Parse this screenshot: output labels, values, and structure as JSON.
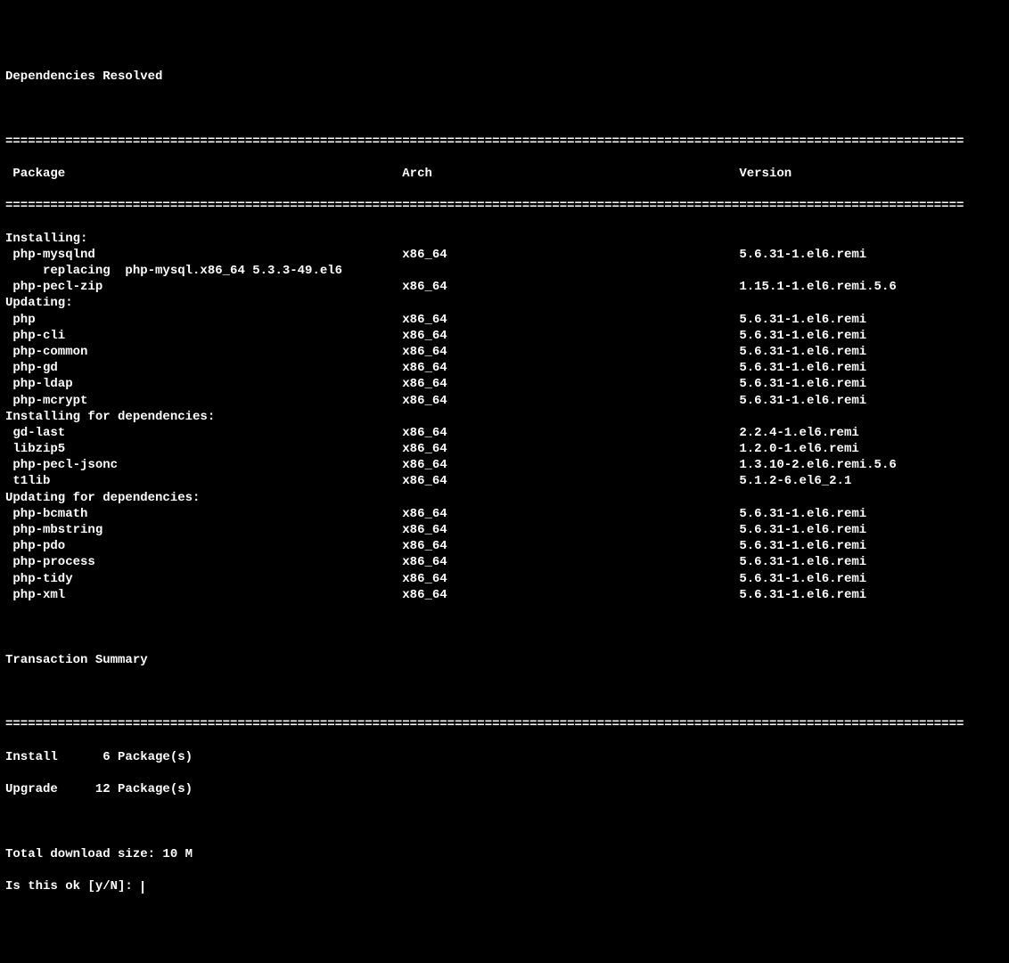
{
  "title": "Dependencies Resolved",
  "separator": "================================================================================================================================",
  "headers": {
    "package": "Package",
    "arch": "Arch",
    "version": "Version"
  },
  "sections": [
    {
      "label": "Installing:",
      "rows": [
        {
          "name": "php-mysqlnd",
          "arch": "x86_64",
          "version": "5.6.31-1.el6.remi",
          "sub": "replacing  php-mysql.x86_64 5.3.3-49.el6"
        },
        {
          "name": "php-pecl-zip",
          "arch": "x86_64",
          "version": "1.15.1-1.el6.remi.5.6"
        }
      ]
    },
    {
      "label": "Updating:",
      "rows": [
        {
          "name": "php",
          "arch": "x86_64",
          "version": "5.6.31-1.el6.remi"
        },
        {
          "name": "php-cli",
          "arch": "x86_64",
          "version": "5.6.31-1.el6.remi"
        },
        {
          "name": "php-common",
          "arch": "x86_64",
          "version": "5.6.31-1.el6.remi"
        },
        {
          "name": "php-gd",
          "arch": "x86_64",
          "version": "5.6.31-1.el6.remi"
        },
        {
          "name": "php-ldap",
          "arch": "x86_64",
          "version": "5.6.31-1.el6.remi"
        },
        {
          "name": "php-mcrypt",
          "arch": "x86_64",
          "version": "5.6.31-1.el6.remi"
        }
      ]
    },
    {
      "label": "Installing for dependencies:",
      "rows": [
        {
          "name": "gd-last",
          "arch": "x86_64",
          "version": "2.2.4-1.el6.remi"
        },
        {
          "name": "libzip5",
          "arch": "x86_64",
          "version": "1.2.0-1.el6.remi"
        },
        {
          "name": "php-pecl-jsonc",
          "arch": "x86_64",
          "version": "1.3.10-2.el6.remi.5.6"
        },
        {
          "name": "t1lib",
          "arch": "x86_64",
          "version": "5.1.2-6.el6_2.1"
        }
      ]
    },
    {
      "label": "Updating for dependencies:",
      "rows": [
        {
          "name": "php-bcmath",
          "arch": "x86_64",
          "version": "5.6.31-1.el6.remi"
        },
        {
          "name": "php-mbstring",
          "arch": "x86_64",
          "version": "5.6.31-1.el6.remi"
        },
        {
          "name": "php-pdo",
          "arch": "x86_64",
          "version": "5.6.31-1.el6.remi"
        },
        {
          "name": "php-process",
          "arch": "x86_64",
          "version": "5.6.31-1.el6.remi"
        },
        {
          "name": "php-tidy",
          "arch": "x86_64",
          "version": "5.6.31-1.el6.remi"
        },
        {
          "name": "php-xml",
          "arch": "x86_64",
          "version": "5.6.31-1.el6.remi"
        }
      ]
    }
  ],
  "summary": {
    "title": "Transaction Summary",
    "install_label": "Install",
    "install_count": "6 Package(s)",
    "upgrade_label": "Upgrade",
    "upgrade_count": "12 Package(s)",
    "download_size": "Total download size: 10 M",
    "prompt": "Is this ok [y/N]: "
  }
}
